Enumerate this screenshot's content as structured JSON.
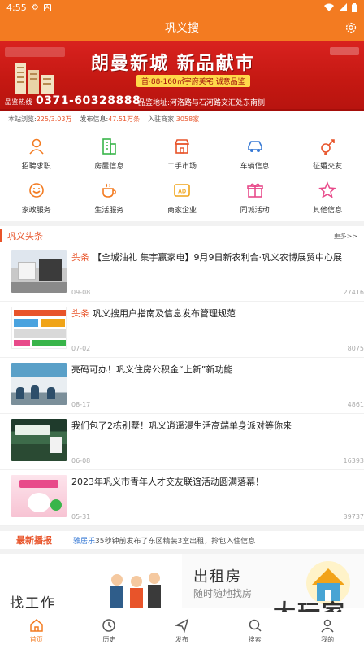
{
  "status_bar": {
    "time": "4:55",
    "a_badge": "A"
  },
  "header": {
    "title": "巩义搜"
  },
  "banner": {
    "slogan": "朗曼新城  新品献市",
    "subline": "首·88-160㎡宇府美宅 诚意品鉴",
    "phone_prefix": "品鉴热线",
    "phone": "0371-60328888",
    "address": "品鉴地址:河洛路与石河路交汇处东南侧"
  },
  "stats": {
    "visits_label": "本站浏览:",
    "visits_value": "225/3.03万",
    "posts_label": "发布信息:",
    "posts_value": "47.51万条",
    "merchants_label": "入驻商家:",
    "merchants_value": "3058家"
  },
  "categories": [
    {
      "label": "招聘求职",
      "icon": "person-icon"
    },
    {
      "label": "房屋信息",
      "icon": "building-icon"
    },
    {
      "label": "二手市场",
      "icon": "shop-icon"
    },
    {
      "label": "车辆信息",
      "icon": "car-icon"
    },
    {
      "label": "征婚交友",
      "icon": "gender-icon"
    },
    {
      "label": "家政服务",
      "icon": "service-icon"
    },
    {
      "label": "生活服务",
      "icon": "cup-icon"
    },
    {
      "label": "商家企业",
      "icon": "ad-icon"
    },
    {
      "label": "同城活动",
      "icon": "gift-icon"
    },
    {
      "label": "其他信息",
      "icon": "star-icon"
    }
  ],
  "headlines": {
    "title": "巩义头条",
    "more": "更多>>",
    "items": [
      {
        "tag": "头条",
        "title": "【全城油礼 集宇赢家电】9月9日新农利合·巩义农博展贸中心展",
        "date": "09-08",
        "views": "27416"
      },
      {
        "tag": "头条",
        "title": "巩义搜用户指南及信息发布管理规范",
        "date": "07-02",
        "views": "8075"
      },
      {
        "tag": "",
        "title": "亮码可办！巩义住房公积金“上新”新功能",
        "date": "08-17",
        "views": "4861"
      },
      {
        "tag": "",
        "title": "我们包了2栋别墅！巩义逍遥漫生活高端单身派对等你来",
        "date": "06-08",
        "views": "16393"
      },
      {
        "tag": "",
        "title": "2023年巩义市青年人才交友联谊活动圆满落幕！",
        "date": "05-31",
        "views": "39737"
      }
    ]
  },
  "ticker": {
    "label": "最新播报",
    "user": "雅居乐",
    "text": "35秒钟前发布了东区精装3室出租，拎包入住信息"
  },
  "promo": {
    "left_title": "找工作",
    "right_title": "出租房",
    "right_sub": "随时随地找房"
  },
  "watermark": "大玩家",
  "tabs": [
    {
      "label": "首页",
      "icon": "home-icon"
    },
    {
      "label": "历史",
      "icon": "clock-icon"
    },
    {
      "label": "发布",
      "icon": "send-icon"
    },
    {
      "label": "搜索",
      "icon": "search-icon"
    },
    {
      "label": "我的",
      "icon": "user-icon"
    }
  ],
  "colors": {
    "accent": "#f37b21",
    "highlight": "#e8542a",
    "banner_red": "#c41812"
  }
}
